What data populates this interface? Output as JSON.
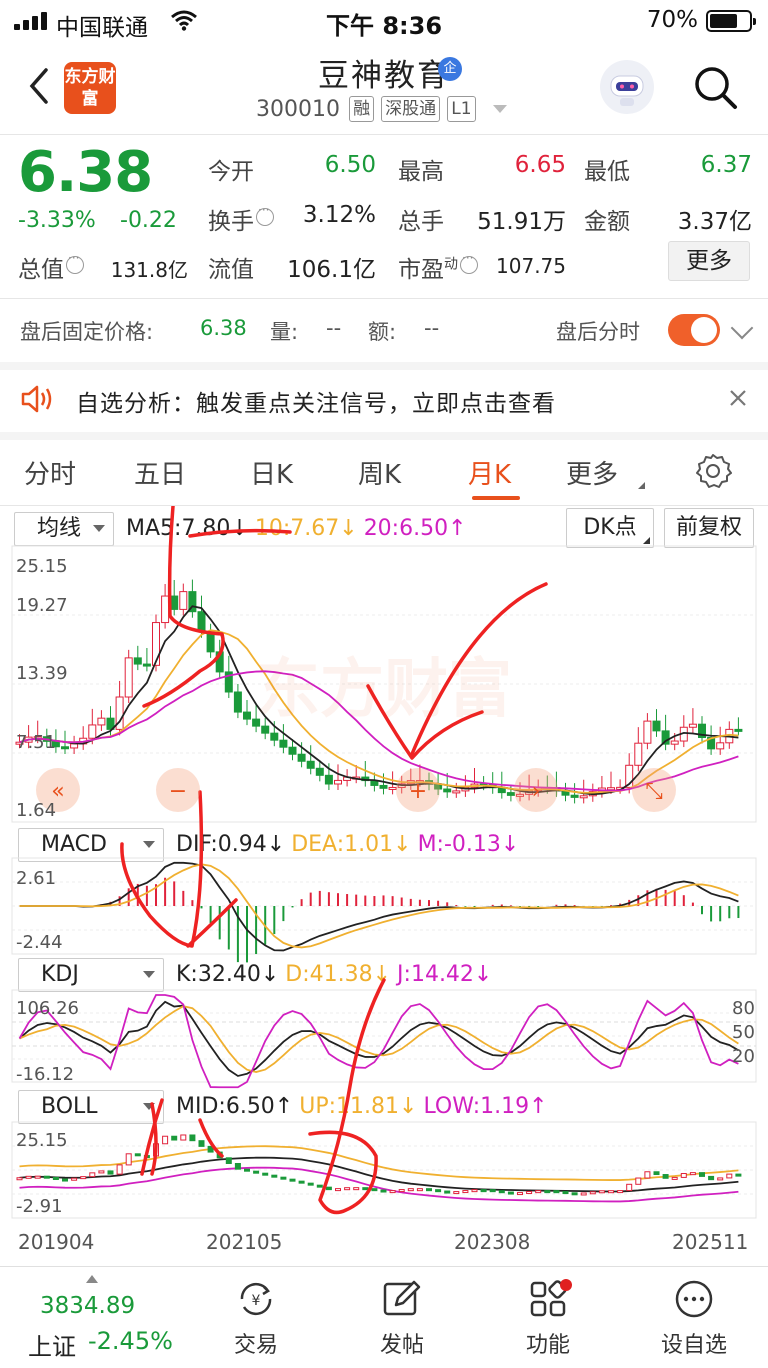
{
  "status_bar": {
    "carrier": "中国联通",
    "time": "下午 8:36",
    "battery": "70%"
  },
  "header": {
    "app_logo": "东方财富",
    "stock_name": "豆神教育",
    "badge": "企",
    "stock_code": "300010",
    "tags": [
      "融",
      "深股通",
      "L1"
    ]
  },
  "quote": {
    "price": "6.38",
    "change_pct": "-3.33%",
    "change_abs": "-0.22",
    "open_label": "今开",
    "open": "6.50",
    "high_label": "最高",
    "high": "6.65",
    "low_label": "最低",
    "low": "6.37",
    "turnover_label": "换手",
    "turnover": "3.12%",
    "volume_label": "总手",
    "volume": "51.91万",
    "amount_label": "金额",
    "amount": "3.37亿",
    "total_cap_label": "总值",
    "total_cap": "131.8亿",
    "float_cap_label": "流值",
    "float_cap": "106.1亿",
    "pe_label": "市盈",
    "pe_sup": "动",
    "pe": "107.75",
    "more": "更多"
  },
  "after_hours": {
    "price_label": "盘后固定价格:",
    "price": "6.38",
    "vol_label": "量:",
    "vol": "--",
    "amt_label": "额:",
    "amt": "--",
    "timeshare_label": "盘后分时"
  },
  "notice": {
    "text": "自选分析：触发重点关注信号，立即点击查看"
  },
  "tabs": {
    "items": [
      "分时",
      "五日",
      "日K",
      "周K",
      "月K",
      "更多"
    ],
    "active": "月K"
  },
  "ma_panel": {
    "selector": "均线",
    "ma5": "MA5:7.80↓",
    "ma10": "10:7.67↓",
    "ma20": "20:6.50↑",
    "dk_button": "DK点",
    "adjust_button": "前复权",
    "y_labels": [
      "25.15",
      "19.27",
      "13.39",
      "7.51",
      "1.64"
    ]
  },
  "macd_panel": {
    "selector": "MACD",
    "dif": "DIF:0.94↓",
    "dea": "DEA:1.01↓",
    "m": "M:-0.13↓",
    "y_labels": [
      "2.61",
      "-2.44"
    ]
  },
  "kdj_panel": {
    "selector": "KDJ",
    "k": "K:32.40↓",
    "d": "D:41.38↓",
    "j": "J:14.42↓",
    "y_labels": [
      "106.26",
      "-16.12"
    ],
    "right_labels": [
      "80",
      "50",
      "20"
    ]
  },
  "boll_panel": {
    "selector": "BOLL",
    "mid": "MID:6.50↑",
    "up": "UP:11.81↓",
    "low": "LOW:1.19↑",
    "y_labels": [
      "25.15",
      "-2.91"
    ]
  },
  "x_labels": [
    "201904",
    "202105",
    "202308",
    "202511"
  ],
  "bottom_nav": {
    "index_value": "3834.89",
    "index_name": "上证",
    "index_pct": "-2.45%",
    "items": [
      "交易",
      "发帖",
      "功能",
      "设自选"
    ]
  },
  "colors": {
    "up": "#e0223b",
    "down": "#1a9a3a",
    "accent": "#e8501c",
    "ma10": "#f0b030",
    "ma20": "#d020c0"
  }
}
